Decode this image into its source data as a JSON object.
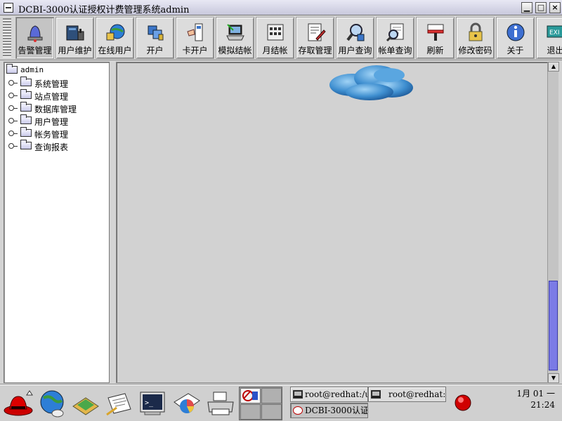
{
  "window": {
    "title": "DCBI-3000认证授权计费管理系统admin",
    "buttons": {
      "minimize": "▁",
      "maximize": "□",
      "close": "×"
    }
  },
  "toolbar": {
    "buttons": [
      {
        "label": "告警管理",
        "icon": "alarm-bell-icon",
        "active": true
      },
      {
        "label": "用户维护",
        "icon": "user-maintenance-icon"
      },
      {
        "label": "在线用户",
        "icon": "online-users-icon"
      },
      {
        "label": "开户",
        "icon": "open-account-icon"
      },
      {
        "label": "卡开户",
        "icon": "card-open-account-icon"
      },
      {
        "label": "模拟结帐",
        "icon": "simulated-checkout-icon"
      },
      {
        "label": "月结帐",
        "icon": "monthly-checkout-icon"
      },
      {
        "label": "存取管理",
        "icon": "deposit-management-icon"
      },
      {
        "label": "用户查询",
        "icon": "user-query-icon"
      },
      {
        "label": "帐单查询",
        "icon": "bill-query-icon"
      },
      {
        "label": "刷新",
        "icon": "refresh-icon"
      },
      {
        "label": "修改密码",
        "icon": "change-password-icon"
      },
      {
        "label": "关于",
        "icon": "about-info-icon"
      },
      {
        "label": "退出",
        "icon": "exit-icon"
      }
    ]
  },
  "tree": {
    "root": "admin",
    "items": [
      "系统管理",
      "站点管理",
      "数据库管理",
      "用户管理",
      "帐务管理",
      "查询报表"
    ]
  },
  "taskbar": {
    "launchers": [
      "redhat-menu-icon",
      "globe-browser-icon",
      "file-manager-icon",
      "text-editor-icon",
      "terminal-icon",
      "office-chart-icon",
      "printer-icon"
    ],
    "tasks": [
      "root@redhat:/usr/l",
      "root@redhat:~",
      "DCBI-3000认证"
    ],
    "clock": {
      "date": "1月 01 一",
      "time": "21:24"
    }
  },
  "colors": {
    "scroll_thumb": "#7b7be6",
    "alert_red": "#d00000"
  }
}
